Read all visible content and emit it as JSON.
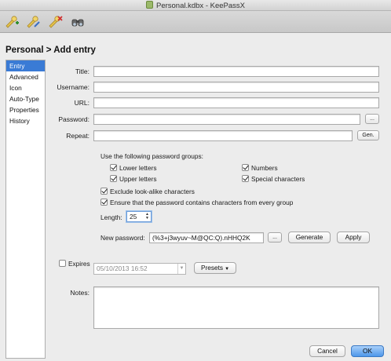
{
  "window": {
    "title": "Personal.kdbx - KeePassX"
  },
  "toolbar": {
    "buttons": [
      {
        "name": "add-entry-icon"
      },
      {
        "name": "edit-entry-icon"
      },
      {
        "name": "delete-entry-icon"
      },
      {
        "name": "search-icon"
      }
    ]
  },
  "header": {
    "breadcrumb": "Personal > Add entry"
  },
  "sidebar": {
    "items": [
      {
        "label": "Entry",
        "active": true
      },
      {
        "label": "Advanced"
      },
      {
        "label": "Icon"
      },
      {
        "label": "Auto-Type"
      },
      {
        "label": "Properties"
      },
      {
        "label": "History"
      }
    ]
  },
  "form": {
    "title_label": "Title:",
    "title_value": "",
    "username_label": "Username:",
    "username_value": "",
    "url_label": "URL:",
    "url_value": "",
    "password_label": "Password:",
    "password_value": "",
    "reveal_button": "...",
    "repeat_label": "Repeat:",
    "repeat_value": "",
    "gen_button": "Gen."
  },
  "generator": {
    "groups_label": "Use the following password groups:",
    "lower_letters": "Lower letters",
    "upper_letters": "Upper letters",
    "numbers": "Numbers",
    "special_characters": "Special characters",
    "exclude_lookalike": "Exclude look-alike characters",
    "every_group": "Ensure that the password contains characters from every group",
    "length_label": "Length:",
    "length_value": "25",
    "new_password_label": "New password:",
    "new_password_value": "(%3+j3wyuv~M@QC:Q).nHHQ2K",
    "reveal_button": "...",
    "generate_button": "Generate",
    "apply_button": "Apply"
  },
  "expiry": {
    "expires_label": "Expires",
    "date_value": "05/10/2013 16:52",
    "presets_button": "Presets"
  },
  "notes": {
    "label": "Notes:",
    "value": ""
  },
  "footer": {
    "cancel_button": "Cancel",
    "ok_button": "OK"
  },
  "colors": {
    "selection": "#3a7bd5",
    "primary_button": "#4d97ea"
  }
}
